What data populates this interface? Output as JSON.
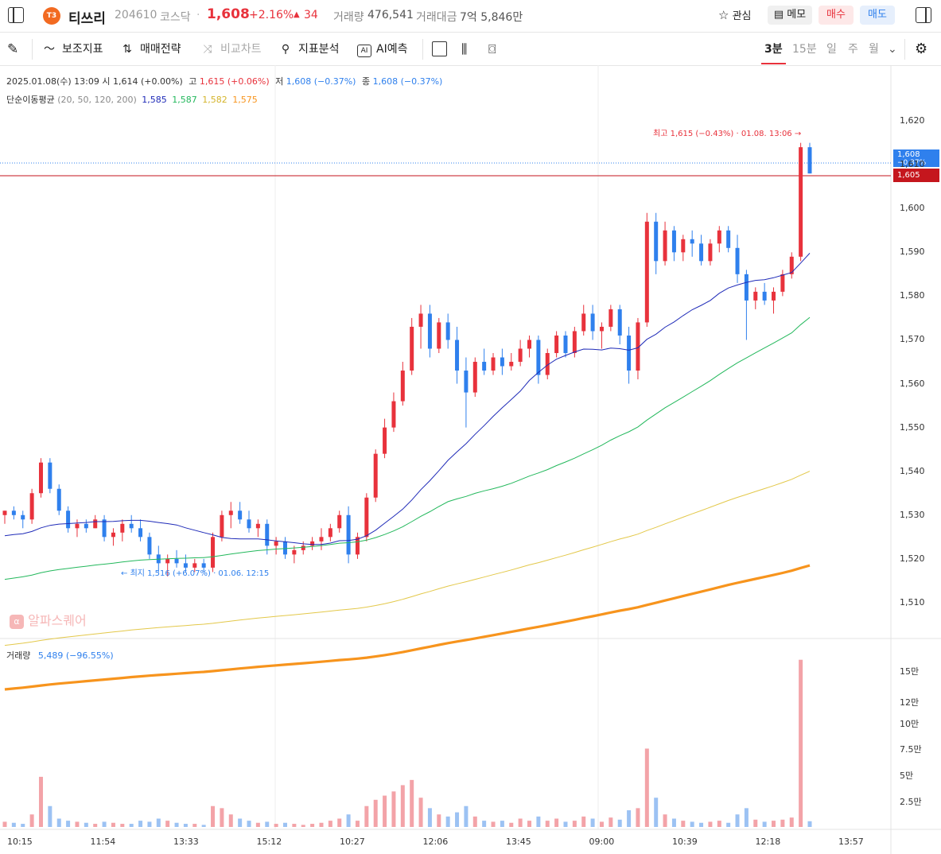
{
  "header": {
    "logo_text": "T3",
    "name": "티쓰리",
    "code": "204610",
    "market": "코스닥",
    "price": "1,608",
    "change_pct": "+2.16%",
    "change_amt": "34",
    "volume_label": "거래량",
    "volume": "476,541",
    "amount_label": "거래대금",
    "amount": "7억 5,846만",
    "watch_label": "관심",
    "memo_label": "메모",
    "buy_label": "매수",
    "sell_label": "매도"
  },
  "toolbar": {
    "items": [
      "보조지표",
      "매매전략",
      "비교차트",
      "지표분석",
      "AI예측"
    ],
    "intervals": [
      "3분",
      "15분",
      "일",
      "주",
      "월"
    ],
    "active_interval": "3분"
  },
  "legend": {
    "date": "2025.01.08(수) 13:09",
    "open_label": "시",
    "open": "1,614 (+0.00%)",
    "high_label": "고",
    "high": "1,615 (+0.06%)",
    "low_label": "저",
    "low": "1,608 (−0.37%)",
    "close_label": "종",
    "close": "1,608 (−0.37%)",
    "ma_label": "단순이동평균",
    "ma_params": "(20, 50, 120, 200)",
    "ma_values": [
      "1,585",
      "1,587",
      "1,582",
      "1,575"
    ],
    "volume_label": "거래량",
    "volume_value": "5,489 (−96.55%)"
  },
  "annotations": {
    "high": "최고 1,615 (−0.43%) · 01.08. 13:06",
    "low": "최지 1,516 (+6.07%) · 01.06. 12:15",
    "price_tag": "1,608",
    "price_tag_sub": "−0.37%",
    "ref_tag": "1,605",
    "watermark": "알파스퀘어"
  },
  "colors": {
    "up": "#e8323c",
    "down": "#2f80ed",
    "ma20": "#1f2bb8",
    "ma50": "#23b85c",
    "ma120": "#e3c84a",
    "ma200": "#f7941d"
  },
  "chart_data": {
    "type": "candlestick",
    "price_ticks": [
      "1,620",
      "1,610",
      "1,600",
      "1,590",
      "1,580",
      "1,570",
      "1,560",
      "1,550",
      "1,540",
      "1,530",
      "1,520",
      "1,510"
    ],
    "price_tick_values": [
      1620,
      1610,
      1600,
      1590,
      1580,
      1570,
      1560,
      1550,
      1540,
      1530,
      1520,
      1510
    ],
    "volume_ticks": [
      "15만",
      "12만",
      "10만",
      "7.5만",
      "5만",
      "2.5만"
    ],
    "volume_tick_values": [
      150000,
      120000,
      100000,
      75000,
      50000,
      25000
    ],
    "time_labels": [
      "10:15",
      "11:54",
      "13:33",
      "15:12",
      "10:27",
      "12:06",
      "13:45",
      "09:00",
      "10:39",
      "12:18",
      "13:57"
    ],
    "price_range": [
      1502,
      1632
    ],
    "volume_max": 175000,
    "ohlc": [
      [
        1530,
        1531,
        1528,
        1531,
        5000
      ],
      [
        1531,
        1532,
        1529,
        1530,
        4000
      ],
      [
        1530,
        1531,
        1527,
        1529,
        3000
      ],
      [
        1529,
        1536,
        1528,
        1535,
        12000
      ],
      [
        1535,
        1543,
        1534,
        1542,
        48000
      ],
      [
        1542,
        1543,
        1535,
        1536,
        20000
      ],
      [
        1536,
        1537,
        1530,
        1531,
        8000
      ],
      [
        1531,
        1532,
        1526,
        1527,
        6000
      ],
      [
        1527,
        1529,
        1525,
        1528,
        5000
      ],
      [
        1528,
        1529,
        1526,
        1527,
        4000
      ],
      [
        1527,
        1530,
        1527,
        1529,
        3000
      ],
      [
        1529,
        1530,
        1524,
        1525,
        5000
      ],
      [
        1525,
        1527,
        1523,
        1526,
        4000
      ],
      [
        1526,
        1529,
        1524,
        1528,
        3000
      ],
      [
        1528,
        1530,
        1526,
        1527,
        3000
      ],
      [
        1527,
        1529,
        1524,
        1525,
        6000
      ],
      [
        1525,
        1526,
        1520,
        1521,
        5000
      ],
      [
        1521,
        1523,
        1517,
        1519,
        8000
      ],
      [
        1519,
        1521,
        1516,
        1520,
        6000
      ],
      [
        1520,
        1522,
        1518,
        1519,
        4000
      ],
      [
        1519,
        1521,
        1517,
        1518,
        3000
      ],
      [
        1518,
        1520,
        1517,
        1519,
        3000
      ],
      [
        1519,
        1520,
        1517,
        1518,
        2000
      ],
      [
        1518,
        1526,
        1517,
        1525,
        20000
      ],
      [
        1525,
        1531,
        1524,
        1530,
        18000
      ],
      [
        1530,
        1533,
        1527,
        1531,
        12000
      ],
      [
        1531,
        1533,
        1528,
        1529,
        8000
      ],
      [
        1529,
        1531,
        1526,
        1527,
        6000
      ],
      [
        1527,
        1529,
        1525,
        1528,
        4000
      ],
      [
        1528,
        1529,
        1521,
        1523,
        5000
      ],
      [
        1523,
        1525,
        1521,
        1524,
        3000
      ],
      [
        1524,
        1525,
        1520,
        1521,
        4000
      ],
      [
        1521,
        1523,
        1519,
        1522,
        3000
      ],
      [
        1522,
        1524,
        1521,
        1523,
        2000
      ],
      [
        1523,
        1525,
        1522,
        1524,
        3000
      ],
      [
        1524,
        1527,
        1522,
        1525,
        4000
      ],
      [
        1525,
        1528,
        1524,
        1527,
        6000
      ],
      [
        1527,
        1531,
        1526,
        1530,
        8000
      ],
      [
        1530,
        1532,
        1519,
        1521,
        12000
      ],
      [
        1521,
        1526,
        1520,
        1525,
        6000
      ],
      [
        1525,
        1535,
        1524,
        1534,
        20000
      ],
      [
        1534,
        1545,
        1533,
        1544,
        26000
      ],
      [
        1544,
        1552,
        1543,
        1550,
        30000
      ],
      [
        1550,
        1558,
        1549,
        1556,
        34000
      ],
      [
        1556,
        1565,
        1555,
        1563,
        40000
      ],
      [
        1563,
        1575,
        1562,
        1573,
        45000
      ],
      [
        1573,
        1578,
        1568,
        1576,
        28000
      ],
      [
        1576,
        1578,
        1566,
        1568,
        18000
      ],
      [
        1568,
        1575,
        1567,
        1574,
        12000
      ],
      [
        1574,
        1576,
        1568,
        1570,
        10000
      ],
      [
        1570,
        1573,
        1560,
        1563,
        14000
      ],
      [
        1563,
        1566,
        1550,
        1558,
        20000
      ],
      [
        1558,
        1566,
        1557,
        1565,
        10000
      ],
      [
        1565,
        1568,
        1562,
        1563,
        6000
      ],
      [
        1563,
        1567,
        1562,
        1566,
        5000
      ],
      [
        1566,
        1568,
        1562,
        1564,
        6000
      ],
      [
        1564,
        1567,
        1563,
        1565,
        4000
      ],
      [
        1565,
        1570,
        1564,
        1568,
        8000
      ],
      [
        1568,
        1571,
        1566,
        1570,
        6000
      ],
      [
        1570,
        1571,
        1560,
        1562,
        10000
      ],
      [
        1562,
        1568,
        1561,
        1567,
        6000
      ],
      [
        1567,
        1572,
        1566,
        1571,
        8000
      ],
      [
        1571,
        1572,
        1566,
        1567,
        5000
      ],
      [
        1567,
        1573,
        1566,
        1572,
        6000
      ],
      [
        1572,
        1578,
        1571,
        1576,
        10000
      ],
      [
        1576,
        1578,
        1570,
        1572,
        8000
      ],
      [
        1572,
        1574,
        1568,
        1573,
        5000
      ],
      [
        1573,
        1578,
        1572,
        1577,
        9000
      ],
      [
        1577,
        1578,
        1569,
        1571,
        7000
      ],
      [
        1571,
        1573,
        1560,
        1563,
        16000
      ],
      [
        1563,
        1575,
        1561,
        1574,
        18000
      ],
      [
        1574,
        1599,
        1573,
        1597,
        75000
      ],
      [
        1597,
        1599,
        1585,
        1588,
        28000
      ],
      [
        1588,
        1597,
        1587,
        1595,
        12000
      ],
      [
        1595,
        1596,
        1588,
        1590,
        8000
      ],
      [
        1590,
        1594,
        1588,
        1593,
        6000
      ],
      [
        1593,
        1595,
        1589,
        1592,
        5000
      ],
      [
        1592,
        1594,
        1587,
        1588,
        4000
      ],
      [
        1588,
        1593,
        1587,
        1592,
        5000
      ],
      [
        1592,
        1596,
        1590,
        1595,
        6000
      ],
      [
        1595,
        1596,
        1590,
        1591,
        4000
      ],
      [
        1591,
        1594,
        1583,
        1585,
        12000
      ],
      [
        1585,
        1586,
        1570,
        1579,
        18000
      ],
      [
        1579,
        1582,
        1577,
        1581,
        7000
      ],
      [
        1581,
        1583,
        1578,
        1579,
        5000
      ],
      [
        1579,
        1582,
        1576,
        1581,
        6000
      ],
      [
        1581,
        1586,
        1580,
        1585,
        7000
      ],
      [
        1585,
        1590,
        1584,
        1589,
        9000
      ],
      [
        1589,
        1615,
        1588,
        1614,
        160000
      ],
      [
        1614,
        1615,
        1608,
        1608,
        5489
      ]
    ]
  }
}
